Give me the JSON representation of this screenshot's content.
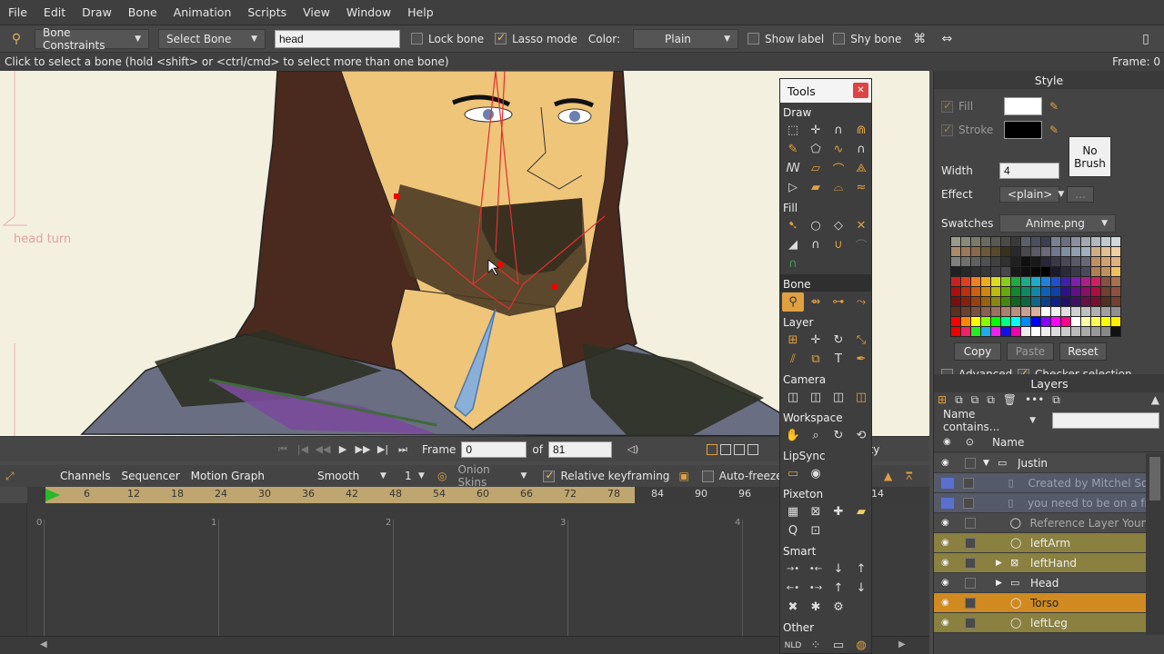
{
  "menu": [
    "File",
    "Edit",
    "Draw",
    "Bone",
    "Animation",
    "Scripts",
    "View",
    "Window",
    "Help"
  ],
  "toolbar": {
    "constraints": "Bone Constraints",
    "select_bone": "Select Bone",
    "bone_name": "head",
    "lock_bone": "Lock bone",
    "lasso_mode": "Lasso mode",
    "color_label": "Color:",
    "color_value": "Plain",
    "show_label": "Show label",
    "shy_bone": "Shy bone"
  },
  "status": {
    "hint": "Click to select a bone (hold <shift> or <ctrl/cmd> to select more than one bone)",
    "frame": "Frame: 0"
  },
  "canvas": {
    "annotation": "head turn"
  },
  "playback": {
    "frame_label": "Frame",
    "frame_value": "0",
    "of_label": "of",
    "total": "81",
    "quality": "uality"
  },
  "timeline": {
    "tabs": [
      "Channels",
      "Sequencer",
      "Motion Graph"
    ],
    "interp": "Smooth",
    "interp_num": "1",
    "onion": "Onion Skins",
    "relative_kf": "Relative keyframing",
    "auto_freeze": "Auto-freeze keys",
    "ruler": [
      "6",
      "12",
      "18",
      "24",
      "30",
      "36",
      "42",
      "48",
      "54",
      "60",
      "66",
      "72",
      "78",
      "84",
      "90",
      "96",
      "14"
    ],
    "ruler_zero": "0",
    "markers": [
      "0",
      "1",
      "2",
      "3",
      "4"
    ]
  },
  "tools": {
    "title": "Tools",
    "sections": [
      "Draw",
      "Fill",
      "Bone",
      "Layer",
      "Camera",
      "Workspace",
      "LipSync",
      "Pixeton",
      "Smart",
      "Other"
    ]
  },
  "style": {
    "title": "Style",
    "fill": "Fill",
    "stroke": "Stroke",
    "no_brush": "No\nBrush",
    "width_label": "Width",
    "width_value": "4",
    "effect_label": "Effect",
    "effect_value": "<plain>",
    "more": "...",
    "swatches_label": "Swatches",
    "swatches_value": "Anime.png",
    "copy": "Copy",
    "paste": "Paste",
    "reset": "Reset",
    "advanced": "Advanced",
    "checker": "Checker selection"
  },
  "layers": {
    "title": "Layers",
    "filter": "Name contains...",
    "name_col": "Name",
    "items": [
      {
        "name": "Justin",
        "type": "group",
        "indent": 0
      },
      {
        "name": "Created by Mitchel So",
        "type": "note",
        "indent": 1
      },
      {
        "name": "you need to be on a fr",
        "type": "note",
        "indent": 1
      },
      {
        "name": "Reference Layer Youn",
        "type": "ref",
        "indent": 1
      },
      {
        "name": "leftArm",
        "type": "bone",
        "indent": 1
      },
      {
        "name": "leftHand",
        "type": "switch",
        "indent": 1
      },
      {
        "name": "Head",
        "type": "group",
        "indent": 1
      },
      {
        "name": "Torso",
        "type": "bone",
        "indent": 1
      },
      {
        "name": "leftLeg",
        "type": "bone",
        "indent": 1
      }
    ]
  }
}
